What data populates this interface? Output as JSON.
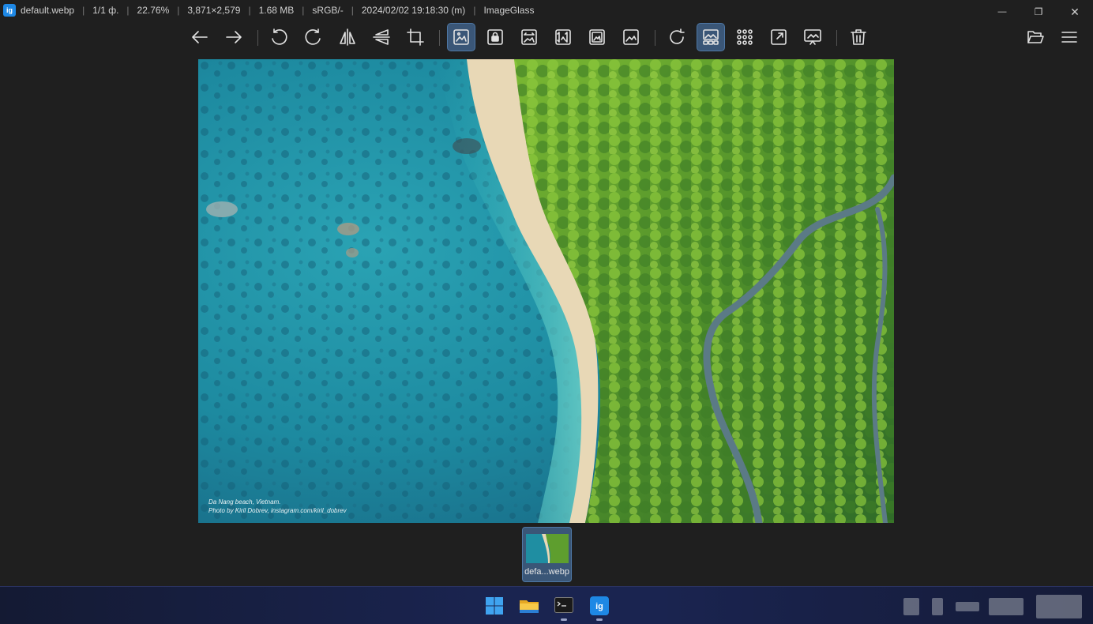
{
  "title_bar": {
    "filename": "default.webp",
    "index": "1/1 ф.",
    "zoom": "22.76%",
    "dimensions": "3,871×2,579",
    "filesize": "1.68 MB",
    "color_profile": "sRGB/-",
    "datetime": "2024/02/02 19:18:30 (m)",
    "app_name": "ImageGlass",
    "app_icon_letter": "ig"
  },
  "window_controls": {
    "minimize": "—",
    "restore": "❐",
    "close": "✕"
  },
  "toolbar": {
    "buttons": [
      {
        "name": "previous-image",
        "icon": "arrow-left-icon",
        "active": false
      },
      {
        "name": "next-image",
        "icon": "arrow-right-icon",
        "active": false
      },
      {
        "name": "rotate-left",
        "icon": "rotate-left-icon",
        "active": false
      },
      {
        "name": "rotate-right",
        "icon": "rotate-right-icon",
        "active": false
      },
      {
        "name": "flip-horizontal",
        "icon": "flip-horizontal-icon",
        "active": false
      },
      {
        "name": "flip-vertical",
        "icon": "flip-vertical-icon",
        "active": false
      },
      {
        "name": "crop",
        "icon": "crop-icon",
        "active": false
      },
      {
        "name": "auto-zoom",
        "icon": "auto-zoom-icon",
        "active": true
      },
      {
        "name": "lock-zoom",
        "icon": "lock-zoom-icon",
        "active": false
      },
      {
        "name": "scale-to-width",
        "icon": "scale-width-icon",
        "active": false
      },
      {
        "name": "scale-to-height",
        "icon": "scale-height-icon",
        "active": false
      },
      {
        "name": "scale-to-fit",
        "icon": "scale-fit-icon",
        "active": false
      },
      {
        "name": "scale-to-fill",
        "icon": "scale-fill-icon",
        "active": false
      },
      {
        "name": "refresh",
        "icon": "refresh-icon",
        "active": false
      },
      {
        "name": "toggle-gallery",
        "icon": "gallery-icon",
        "active": true
      },
      {
        "name": "toggle-checkerboard",
        "icon": "grid-icon",
        "active": false
      },
      {
        "name": "fullscreen",
        "icon": "fullscreen-icon",
        "active": false
      },
      {
        "name": "slideshow",
        "icon": "slideshow-icon",
        "active": false
      },
      {
        "name": "delete",
        "icon": "trash-icon",
        "active": false
      },
      {
        "name": "open-file",
        "icon": "folder-open-icon",
        "active": false
      },
      {
        "name": "main-menu",
        "icon": "hamburger-menu-icon",
        "active": false
      }
    ]
  },
  "image": {
    "caption_line1": "Da Nang beach, Vietnam.",
    "caption_line2": "Photo by Kiril Dobrev, instagram.com/kiril_dobrev"
  },
  "gallery": {
    "items": [
      {
        "label": "defa...webp",
        "selected": true
      }
    ]
  },
  "taskbar": {
    "apps": [
      {
        "name": "start",
        "icon": "windows-start-icon"
      },
      {
        "name": "file-explorer",
        "icon": "file-explorer-icon"
      },
      {
        "name": "terminal",
        "icon": "terminal-icon"
      },
      {
        "name": "imageglass",
        "icon": "imageglass-app-icon"
      }
    ]
  },
  "colors": {
    "background": "#1f1f1f",
    "accent": "#3a5677",
    "accent_border": "#4e78a6",
    "app_icon": "#1e88e5"
  }
}
